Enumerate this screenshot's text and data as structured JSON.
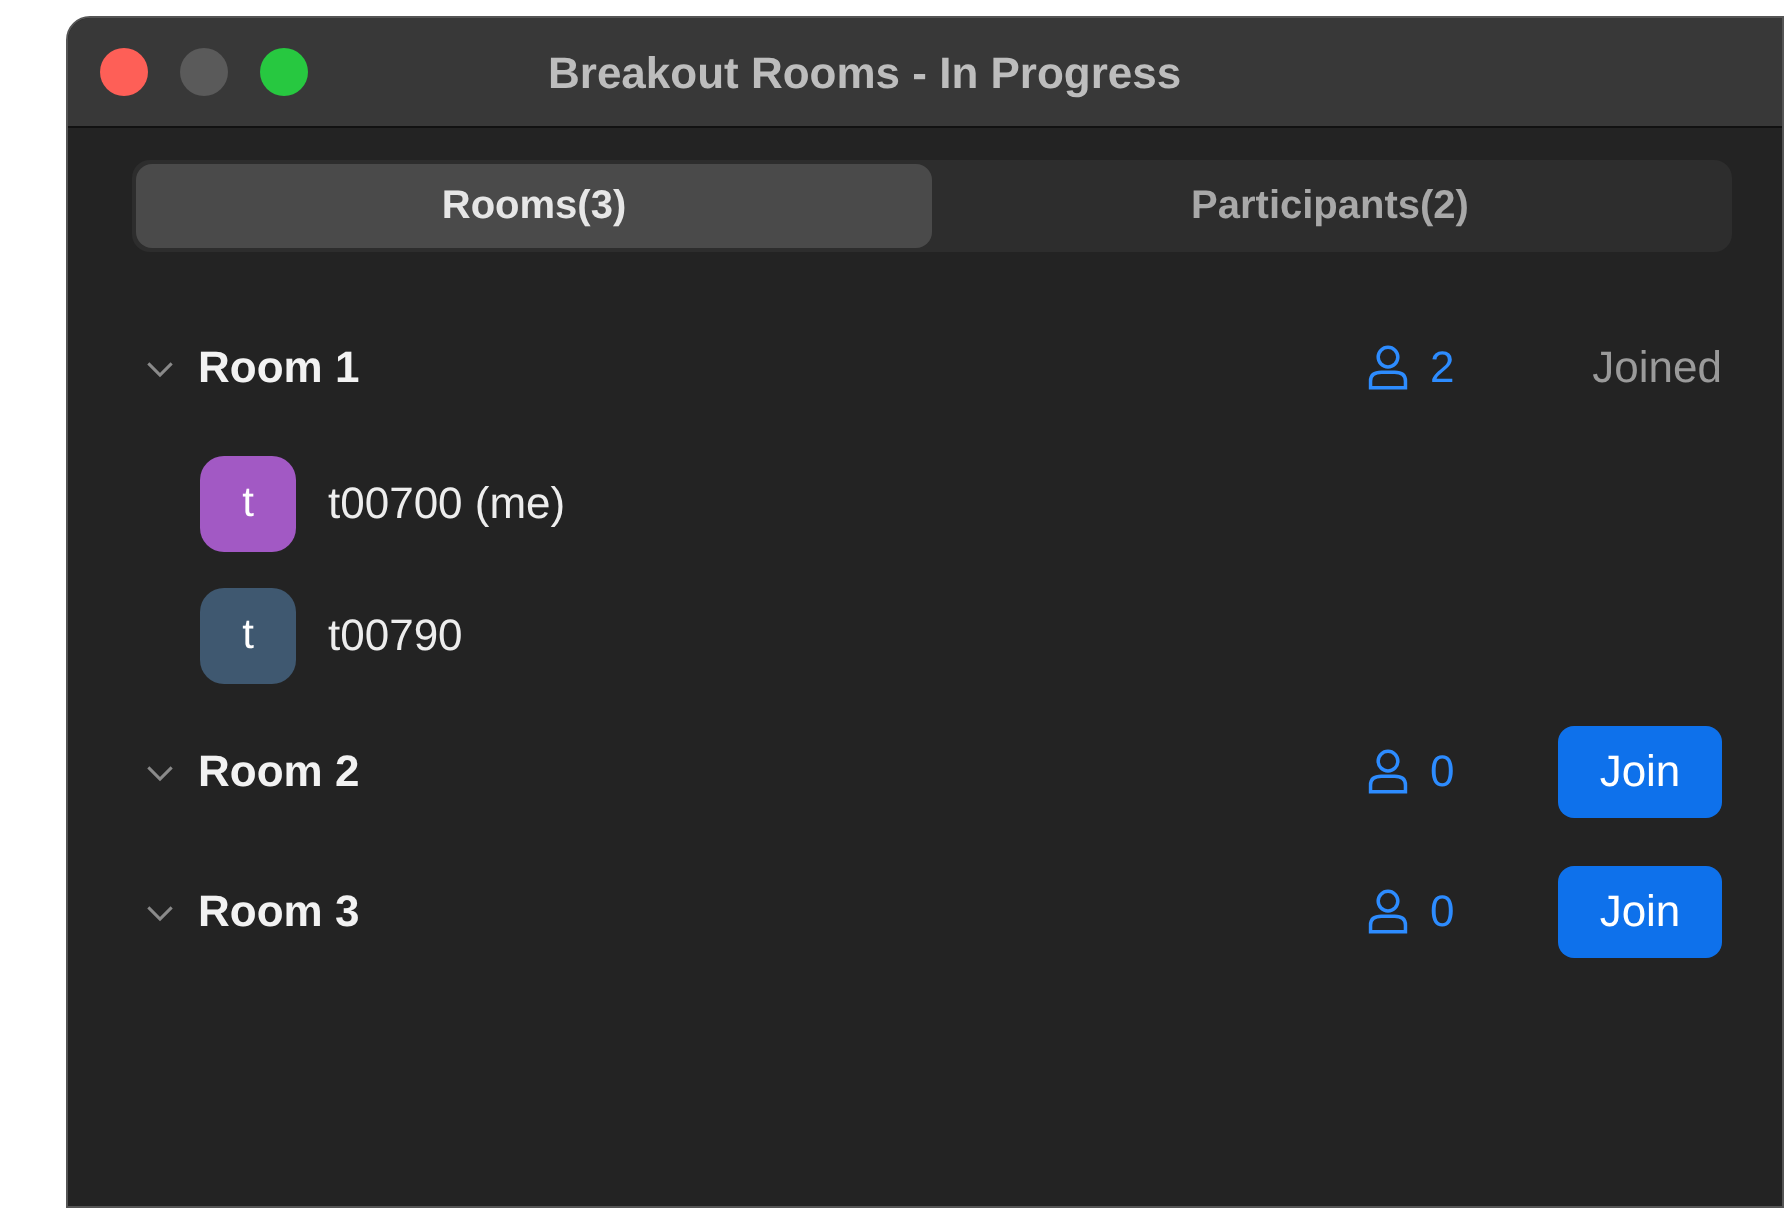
{
  "window": {
    "title": "Breakout Rooms - In Progress"
  },
  "tabs": [
    {
      "label": "Rooms(3)",
      "selected": true
    },
    {
      "label": "Participants(2)",
      "selected": false
    }
  ],
  "rooms": [
    {
      "name": "Room 1",
      "expanded": true,
      "count": "2",
      "action": {
        "kind": "status",
        "label": "Joined"
      },
      "members": [
        {
          "initial": "t",
          "name": "t00700 (me)",
          "color": "#a259c4"
        },
        {
          "initial": "t",
          "name": "t00790",
          "color": "#3f5870"
        }
      ]
    },
    {
      "name": "Room 2",
      "expanded": true,
      "count": "0",
      "action": {
        "kind": "button",
        "label": "Join"
      }
    },
    {
      "name": "Room 3",
      "expanded": true,
      "count": "0",
      "action": {
        "kind": "button",
        "label": "Join"
      }
    }
  ]
}
